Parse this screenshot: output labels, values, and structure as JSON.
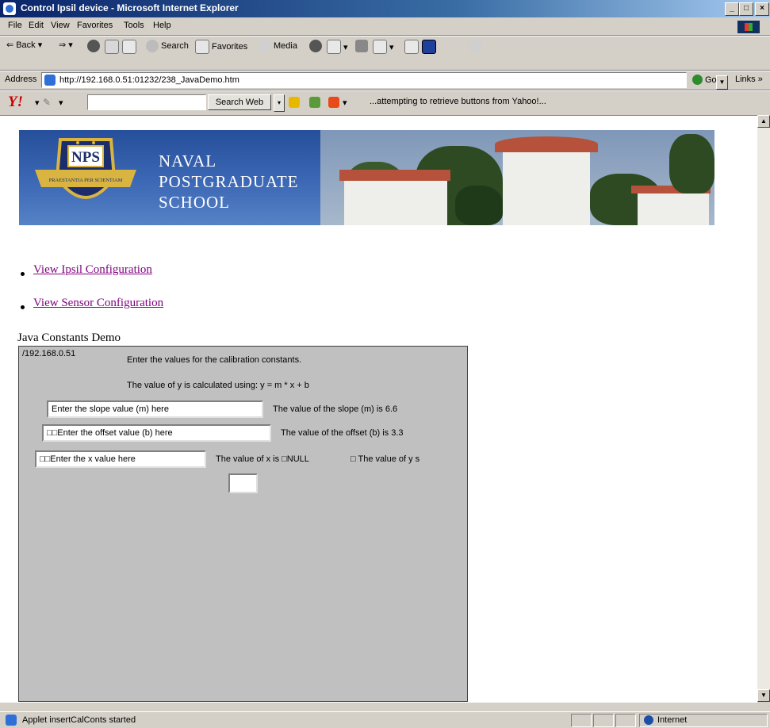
{
  "window": {
    "title": "Control Ipsil device - Microsoft Internet Explorer"
  },
  "menubar": {
    "items": [
      "File",
      "Edit",
      "View",
      "Favorites",
      "Tools",
      "Help"
    ]
  },
  "toolbar": {
    "back": "Back",
    "search": "Search",
    "favorites": "Favorites",
    "media": "Media"
  },
  "address": {
    "label": "Address",
    "url": "http://192.168.0.51:01232/238_JavaDemo.htm",
    "go": "Go",
    "links": "Links"
  },
  "yahoo": {
    "logo": "Y!",
    "search_placeholder": "",
    "search_button": "Search Web",
    "status": "...attempting to retrieve buttons from Yahoo!..."
  },
  "banner": {
    "line1": "NAVAL",
    "line2": "POSTGRADUATE",
    "line3": "SCHOOL",
    "seal_text": "NPS",
    "seal_motto": "PRAESTANTIA PER SCIENTIAM"
  },
  "links": [
    "View Ipsil Configuration",
    "View Sensor Configuration"
  ],
  "applet_label": "Java Constants Demo",
  "applet": {
    "host": "/192.168.0.51",
    "instruction": "Enter the values for the calibration constants.",
    "formula": "The value of y is calculated using: y = m * x + b",
    "slope_input": "Enter the slope value (m) here",
    "slope_value": "The value of the slope (m) is 6.6",
    "offset_input": "□□Enter the offset value (b) here",
    "offset_value": "The value of the offset (b) is 3.3",
    "x_input": "□□Enter the x value here",
    "x_value": "The value of x is □NULL",
    "y_value": "□ The value of y s"
  },
  "status": {
    "text": "Applet insertCalConts started",
    "zone": "Internet"
  }
}
